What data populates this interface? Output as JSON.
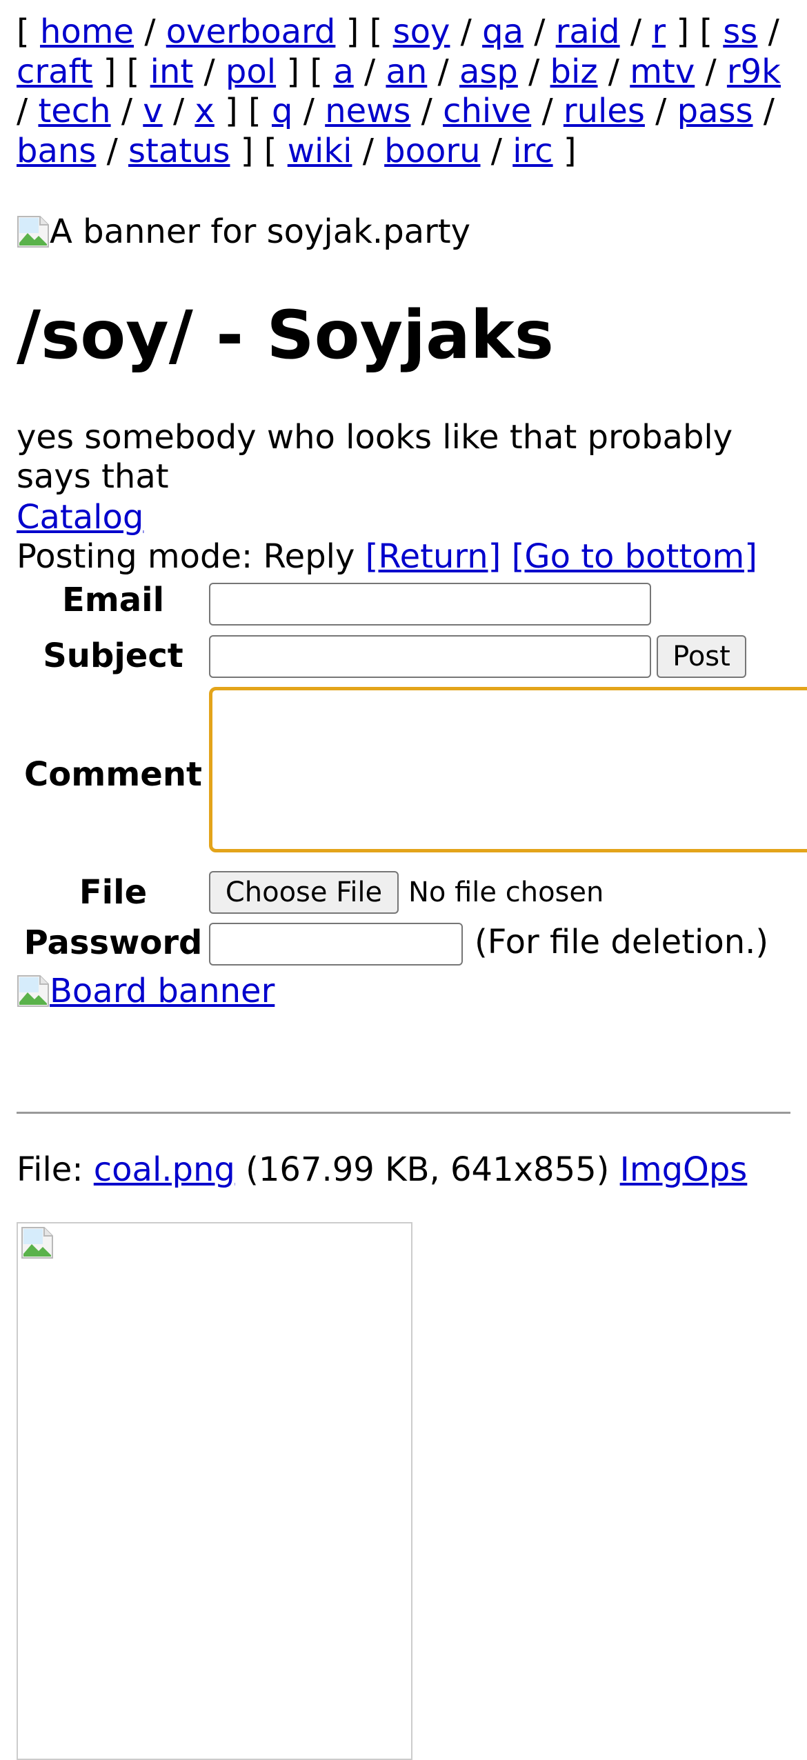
{
  "boardlist": {
    "groups": [
      [
        "home",
        "overboard"
      ],
      [
        "soy",
        "qa",
        "raid",
        "r"
      ],
      [
        "ss",
        "craft"
      ],
      [
        "int",
        "pol"
      ],
      [
        "a",
        "an",
        "asp",
        "biz",
        "mtv",
        "r9k",
        "tech",
        "v",
        "x"
      ],
      [
        "q",
        "news",
        "chive",
        "rules",
        "pass",
        "bans",
        "status"
      ],
      [
        "wiki",
        "booru",
        "irc"
      ]
    ]
  },
  "banner": {
    "alt_text": "A banner for soyjak.party",
    "icon": "broken-image-icon"
  },
  "board": {
    "title": "/soy/ - Soyjaks",
    "subtitle": "yes somebody who looks like that probably says that",
    "catalog_label": "Catalog"
  },
  "posting": {
    "mode_text": "Posting mode: Reply",
    "return_label": "[Return]",
    "bottom_label": "[Go to bottom]"
  },
  "form": {
    "email_label": "Email",
    "email_value": "",
    "subject_label": "Subject",
    "subject_value": "",
    "post_button": "Post",
    "comment_label": "Comment",
    "comment_value": "",
    "file_label": "File",
    "choose_file_button": "Choose File",
    "no_file_text": "No file chosen",
    "password_label": "Password",
    "password_value": "",
    "password_note": "(For file deletion.)",
    "focus_color": "#e3a41a"
  },
  "board_banner": {
    "label": "Board banner",
    "icon": "broken-image-icon"
  },
  "thread": {
    "file_prefix": "File:",
    "file_name": "coal.png",
    "file_glyph": "",
    "file_details": "(167.99 KB, 641x855)",
    "imgops_label": "ImgOps",
    "thumb_icon": "broken-image-icon"
  },
  "colors": {
    "link": "#0000cc",
    "text": "#000000",
    "background": "#ffffff",
    "rule": "#999999"
  }
}
